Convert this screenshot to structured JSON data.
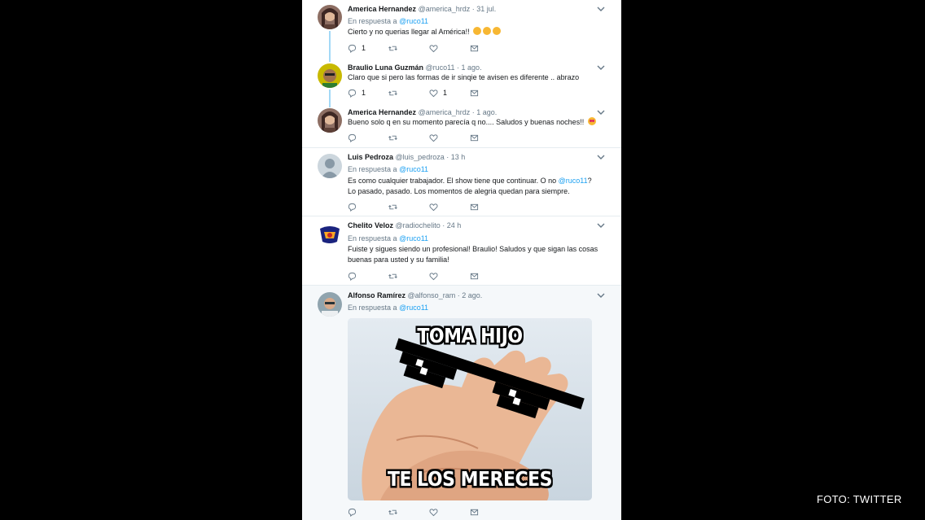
{
  "tweets": [
    {
      "name": "America Hernandez",
      "handle": "@america_hrdz",
      "time": "· 31 jul.",
      "reply_prefix": "En respuesta a",
      "reply_to": "@ruco11",
      "text": "Cierto y no querias llegar al América!!",
      "reply_count": "1",
      "retweet_count": "",
      "like_count": ""
    },
    {
      "name": "Braulio Luna Guzmán",
      "handle": "@ruco11",
      "time": "· 1 ago.",
      "text": "Claro que si pero las formas de ir sinqie te avisen es diferente .. abrazo",
      "reply_count": "1",
      "retweet_count": "",
      "like_count": "1"
    },
    {
      "name": "America Hernandez",
      "handle": "@america_hrdz",
      "time": "· 1 ago.",
      "text": "Bueno  solo q en su momento parecía q no.... Saludos y buenas noches!!",
      "reply_count": "",
      "retweet_count": "",
      "like_count": ""
    },
    {
      "name": "Luis Pedroza",
      "handle": "@luis_pedroza",
      "time": "· 13 h",
      "reply_prefix": "En respuesta a",
      "reply_to": "@ruco11",
      "text_before": "Es como cualquier trabajador. El show tiene que continuar. O no ",
      "text_mention": "@ruco11",
      "text_after": "? Lo pasado, pasado. Los momentos de alegria quedan para siempre.",
      "reply_count": "",
      "retweet_count": "",
      "like_count": ""
    },
    {
      "name": "Chelito Veloz",
      "handle": "@radiochelito",
      "time": "· 24 h",
      "reply_prefix": "En respuesta a",
      "reply_to": "@ruco11",
      "text": "Fuiste y sigues siendo un profesional! Braulio! Saludos y que sigan las cosas buenas para usted y su familia!",
      "reply_count": "",
      "retweet_count": "",
      "like_count": ""
    },
    {
      "name": "Alfonso Ramírez",
      "handle": "@alfonso_ram",
      "time": "· 2 ago.",
      "reply_prefix": "En respuesta a",
      "reply_to": "@ruco11",
      "meme_top": "TOMA HIJO",
      "meme_bottom": "TE LOS MERECES",
      "reply_count": "",
      "retweet_count": "",
      "like_count": ""
    }
  ],
  "icons": [
    "reply-icon",
    "retweet-icon",
    "like-icon",
    "message-icon",
    "caret-down-icon"
  ],
  "colors": {
    "link": "#1da1f2",
    "thread_line": "#a3d9f6",
    "name": "#14171a",
    "meta": "#657786"
  },
  "credit": "FOTO: TWITTER"
}
